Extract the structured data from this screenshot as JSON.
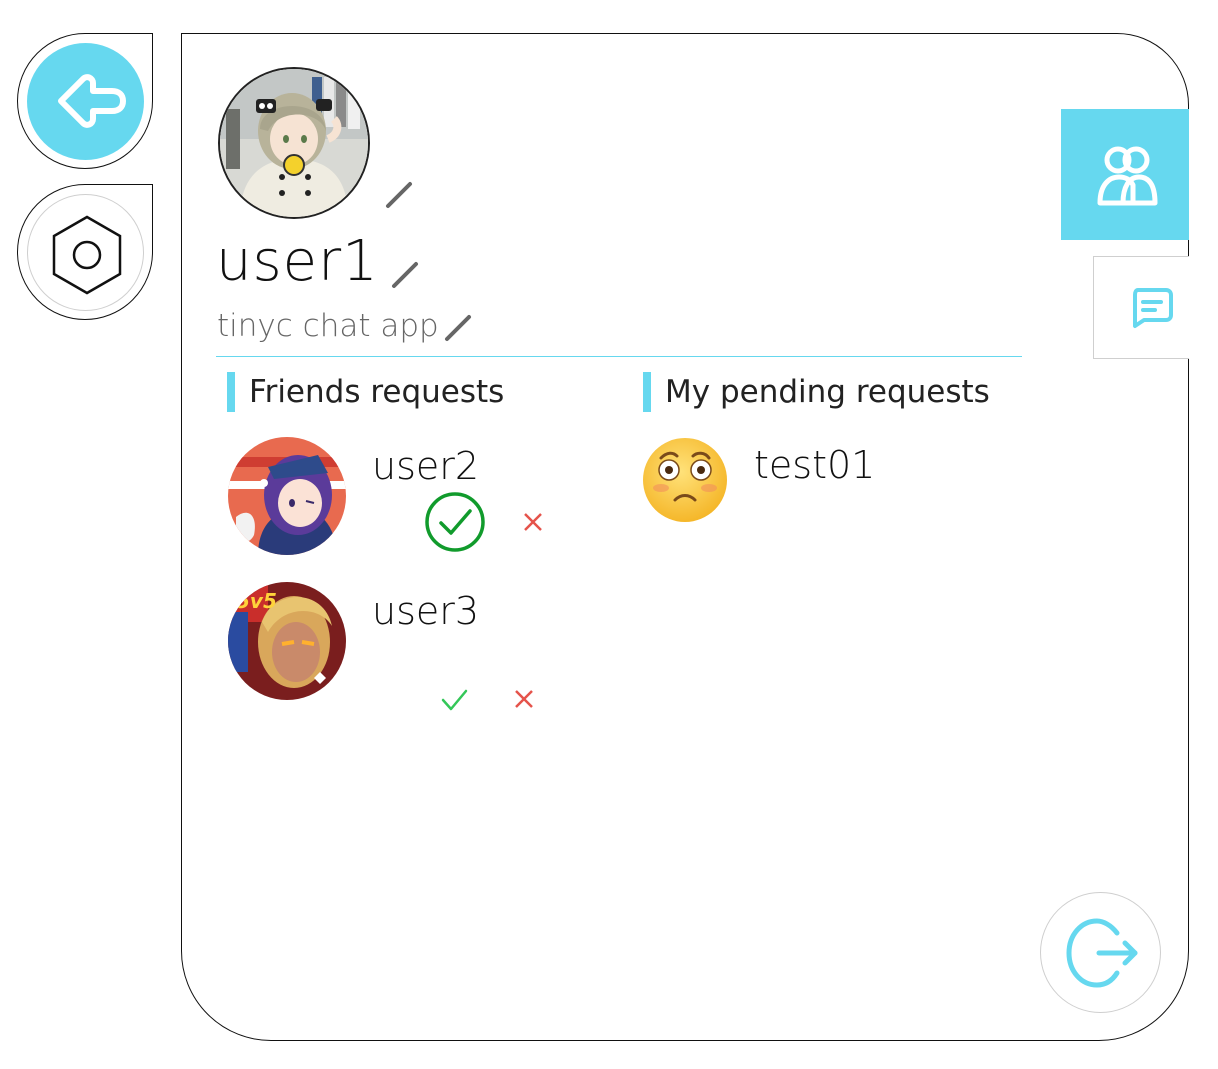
{
  "profile": {
    "username": "user1",
    "status": "tinyc chat app"
  },
  "friend_requests": {
    "title": "Friends requests",
    "items": [
      {
        "name": "user2"
      },
      {
        "name": "user3"
      }
    ]
  },
  "pending_requests": {
    "title": "My pending requests",
    "items": [
      {
        "name": "test01"
      }
    ]
  },
  "colors": {
    "accent": "#66d8ef",
    "accept": "#119b2c",
    "accept_light": "#34c759",
    "reject": "#e5534b"
  },
  "icons": {
    "back": "arrow-left-icon",
    "settings": "hexagon-nut-icon",
    "friends_tab": "users-icon",
    "chats_tab": "message-icon",
    "logout": "logout-icon",
    "edit": "pencil-icon",
    "accept": "check-icon",
    "reject": "close-icon"
  }
}
